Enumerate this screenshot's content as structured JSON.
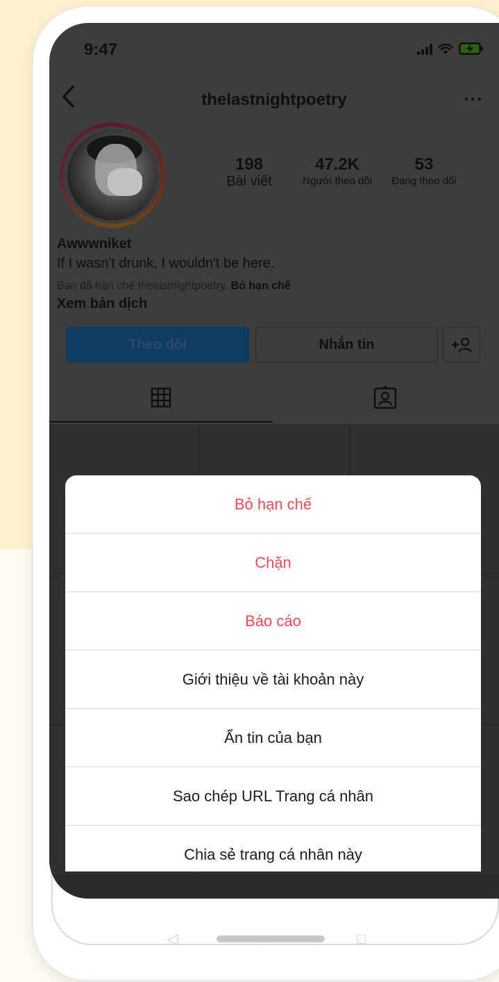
{
  "status_bar": {
    "time": "9:47"
  },
  "header": {
    "username": "thelastnightpoetry",
    "more_label": "···"
  },
  "profile": {
    "stats": [
      {
        "value": "198",
        "label": "Bài viết"
      },
      {
        "value": "47.2K",
        "label": "Người theo dõi"
      },
      {
        "value": "53",
        "label": "Đang theo dõi"
      }
    ],
    "name": "Awwwniket",
    "bio": "If I wasn't drunk, I wouldn't be here.",
    "restricted_text": "Bạn đã hạn chế thelastnightpoetry.",
    "unrestrict_link": "Bỏ hạn chế",
    "translate_link": "Xem bản dịch"
  },
  "buttons": {
    "follow": "Theo dõi",
    "message": "Nhắn tin",
    "add_person": "+"
  },
  "action_sheet": {
    "items": [
      {
        "label": "Bỏ hạn chế",
        "danger": true
      },
      {
        "label": "Chặn",
        "danger": true
      },
      {
        "label": "Báo cáo",
        "danger": true
      },
      {
        "label": "Giới thiệu về tài khoản này",
        "danger": false
      },
      {
        "label": "Ẩn tin của bạn",
        "danger": false
      },
      {
        "label": "Sao chép URL Trang cá nhân",
        "danger": false
      },
      {
        "label": "Chia sẻ trang cá nhân này",
        "danger": false
      }
    ]
  },
  "icons": {
    "back": "chevron-left-icon",
    "grid": "grid-icon",
    "tagged": "tagged-person-icon",
    "add_person": "add-person-icon"
  },
  "colors": {
    "danger": "#ed4956",
    "follow_button": "#103c62",
    "dim_background": "#3d3d3d",
    "page_background": "#fdf1cf"
  }
}
